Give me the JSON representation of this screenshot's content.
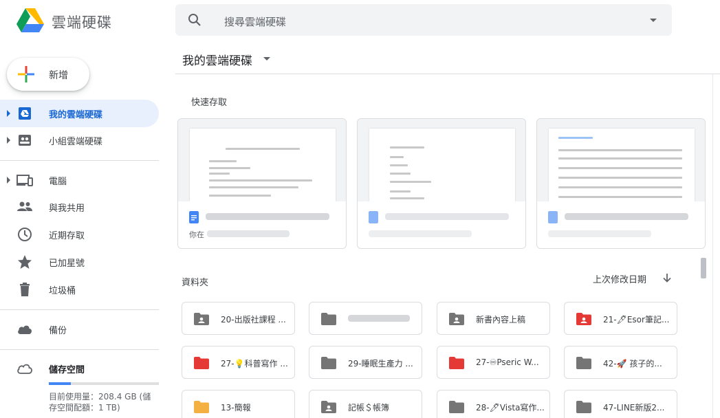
{
  "app": {
    "title": "雲端硬碟"
  },
  "search": {
    "placeholder": "搜尋雲端硬碟"
  },
  "new_button": {
    "label": "新增"
  },
  "sidebar": {
    "items": [
      {
        "label": "我的雲端硬碟",
        "icon": "my-drive-icon",
        "active": true
      },
      {
        "label": "小組雲端硬碟",
        "icon": "shared-drives-icon"
      },
      {
        "label": "電腦",
        "icon": "computers-icon"
      },
      {
        "label": "與我共用",
        "icon": "shared-with-me-icon"
      },
      {
        "label": "近期存取",
        "icon": "clock-icon"
      },
      {
        "label": "已加星號",
        "icon": "star-icon"
      },
      {
        "label": "垃圾桶",
        "icon": "trash-icon"
      },
      {
        "label": "備份",
        "icon": "cloud-icon"
      },
      {
        "label": "儲存空間",
        "icon": "cloud-outline-icon"
      }
    ],
    "storage": {
      "used_text": "目前使用量：208.4 GB (儲存空間配額：1 TB)",
      "used_fraction": 0.2
    }
  },
  "main": {
    "title": "我的雲端硬碟",
    "quick_access_label": "快速存取",
    "quick_access": [
      {
        "subtitle": "你在",
        "icon_color": "#4285f4"
      },
      {
        "subtitle": "",
        "icon_color": "#8ab4f8"
      },
      {
        "subtitle": "",
        "icon_color": "#8ab4f8"
      }
    ],
    "folders_label": "資料夾",
    "sort_label": "上次修改日期",
    "folders": [
      {
        "name": "20-出版社課程 ...",
        "color": "#757575",
        "shared": true
      },
      {
        "name": "",
        "color": "#757575",
        "shared": false
      },
      {
        "name": "新書內容上稿",
        "color": "#757575",
        "shared": true
      },
      {
        "name": "21-🖋Esor筆記...",
        "color": "#e53935",
        "shared": true
      },
      {
        "name": "27-💡科普寫作 ...",
        "color": "#e53935",
        "shared": false
      },
      {
        "name": "29-睡眠生產力 ...",
        "color": "#757575",
        "shared": false
      },
      {
        "name": "27-♾Pseric W...",
        "color": "#e53935",
        "shared": false
      },
      {
        "name": "42-🚀 孩子的...",
        "color": "#757575",
        "shared": false
      },
      {
        "name": "13-簡報",
        "color": "#f4b142",
        "shared": false
      },
      {
        "name": "記帳＄帳簿",
        "color": "#757575",
        "shared": true
      },
      {
        "name": "28-🖊Vista寫作...",
        "color": "#757575",
        "shared": false
      },
      {
        "name": "47-LINE新版2...",
        "color": "#757575",
        "shared": false
      }
    ]
  }
}
